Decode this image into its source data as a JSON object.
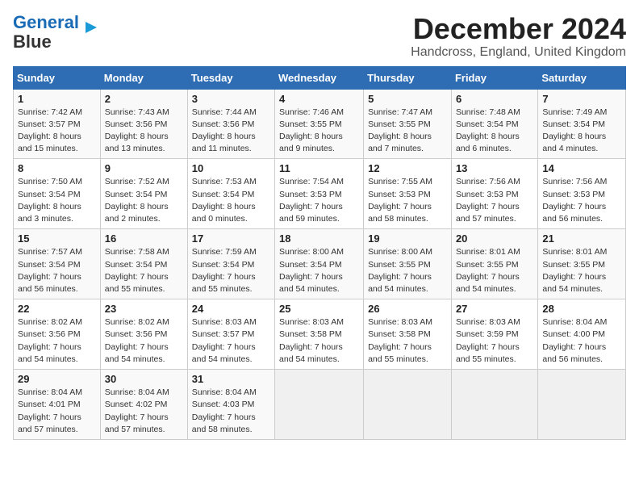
{
  "header": {
    "logo_line1": "General",
    "logo_line2": "Blue",
    "title": "December 2024",
    "subtitle": "Handcross, England, United Kingdom"
  },
  "days_of_week": [
    "Sunday",
    "Monday",
    "Tuesday",
    "Wednesday",
    "Thursday",
    "Friday",
    "Saturday"
  ],
  "weeks": [
    [
      {
        "day": "1",
        "info": "Sunrise: 7:42 AM\nSunset: 3:57 PM\nDaylight: 8 hours\nand 15 minutes."
      },
      {
        "day": "2",
        "info": "Sunrise: 7:43 AM\nSunset: 3:56 PM\nDaylight: 8 hours\nand 13 minutes."
      },
      {
        "day": "3",
        "info": "Sunrise: 7:44 AM\nSunset: 3:56 PM\nDaylight: 8 hours\nand 11 minutes."
      },
      {
        "day": "4",
        "info": "Sunrise: 7:46 AM\nSunset: 3:55 PM\nDaylight: 8 hours\nand 9 minutes."
      },
      {
        "day": "5",
        "info": "Sunrise: 7:47 AM\nSunset: 3:55 PM\nDaylight: 8 hours\nand 7 minutes."
      },
      {
        "day": "6",
        "info": "Sunrise: 7:48 AM\nSunset: 3:54 PM\nDaylight: 8 hours\nand 6 minutes."
      },
      {
        "day": "7",
        "info": "Sunrise: 7:49 AM\nSunset: 3:54 PM\nDaylight: 8 hours\nand 4 minutes."
      }
    ],
    [
      {
        "day": "8",
        "info": "Sunrise: 7:50 AM\nSunset: 3:54 PM\nDaylight: 8 hours\nand 3 minutes."
      },
      {
        "day": "9",
        "info": "Sunrise: 7:52 AM\nSunset: 3:54 PM\nDaylight: 8 hours\nand 2 minutes."
      },
      {
        "day": "10",
        "info": "Sunrise: 7:53 AM\nSunset: 3:54 PM\nDaylight: 8 hours\nand 0 minutes."
      },
      {
        "day": "11",
        "info": "Sunrise: 7:54 AM\nSunset: 3:53 PM\nDaylight: 7 hours\nand 59 minutes."
      },
      {
        "day": "12",
        "info": "Sunrise: 7:55 AM\nSunset: 3:53 PM\nDaylight: 7 hours\nand 58 minutes."
      },
      {
        "day": "13",
        "info": "Sunrise: 7:56 AM\nSunset: 3:53 PM\nDaylight: 7 hours\nand 57 minutes."
      },
      {
        "day": "14",
        "info": "Sunrise: 7:56 AM\nSunset: 3:53 PM\nDaylight: 7 hours\nand 56 minutes."
      }
    ],
    [
      {
        "day": "15",
        "info": "Sunrise: 7:57 AM\nSunset: 3:54 PM\nDaylight: 7 hours\nand 56 minutes."
      },
      {
        "day": "16",
        "info": "Sunrise: 7:58 AM\nSunset: 3:54 PM\nDaylight: 7 hours\nand 55 minutes."
      },
      {
        "day": "17",
        "info": "Sunrise: 7:59 AM\nSunset: 3:54 PM\nDaylight: 7 hours\nand 55 minutes."
      },
      {
        "day": "18",
        "info": "Sunrise: 8:00 AM\nSunset: 3:54 PM\nDaylight: 7 hours\nand 54 minutes."
      },
      {
        "day": "19",
        "info": "Sunrise: 8:00 AM\nSunset: 3:55 PM\nDaylight: 7 hours\nand 54 minutes."
      },
      {
        "day": "20",
        "info": "Sunrise: 8:01 AM\nSunset: 3:55 PM\nDaylight: 7 hours\nand 54 minutes."
      },
      {
        "day": "21",
        "info": "Sunrise: 8:01 AM\nSunset: 3:55 PM\nDaylight: 7 hours\nand 54 minutes."
      }
    ],
    [
      {
        "day": "22",
        "info": "Sunrise: 8:02 AM\nSunset: 3:56 PM\nDaylight: 7 hours\nand 54 minutes."
      },
      {
        "day": "23",
        "info": "Sunrise: 8:02 AM\nSunset: 3:56 PM\nDaylight: 7 hours\nand 54 minutes."
      },
      {
        "day": "24",
        "info": "Sunrise: 8:03 AM\nSunset: 3:57 PM\nDaylight: 7 hours\nand 54 minutes."
      },
      {
        "day": "25",
        "info": "Sunrise: 8:03 AM\nSunset: 3:58 PM\nDaylight: 7 hours\nand 54 minutes."
      },
      {
        "day": "26",
        "info": "Sunrise: 8:03 AM\nSunset: 3:58 PM\nDaylight: 7 hours\nand 55 minutes."
      },
      {
        "day": "27",
        "info": "Sunrise: 8:03 AM\nSunset: 3:59 PM\nDaylight: 7 hours\nand 55 minutes."
      },
      {
        "day": "28",
        "info": "Sunrise: 8:04 AM\nSunset: 4:00 PM\nDaylight: 7 hours\nand 56 minutes."
      }
    ],
    [
      {
        "day": "29",
        "info": "Sunrise: 8:04 AM\nSunset: 4:01 PM\nDaylight: 7 hours\nand 57 minutes."
      },
      {
        "day": "30",
        "info": "Sunrise: 8:04 AM\nSunset: 4:02 PM\nDaylight: 7 hours\nand 57 minutes."
      },
      {
        "day": "31",
        "info": "Sunrise: 8:04 AM\nSunset: 4:03 PM\nDaylight: 7 hours\nand 58 minutes."
      },
      {
        "day": "",
        "info": ""
      },
      {
        "day": "",
        "info": ""
      },
      {
        "day": "",
        "info": ""
      },
      {
        "day": "",
        "info": ""
      }
    ]
  ]
}
